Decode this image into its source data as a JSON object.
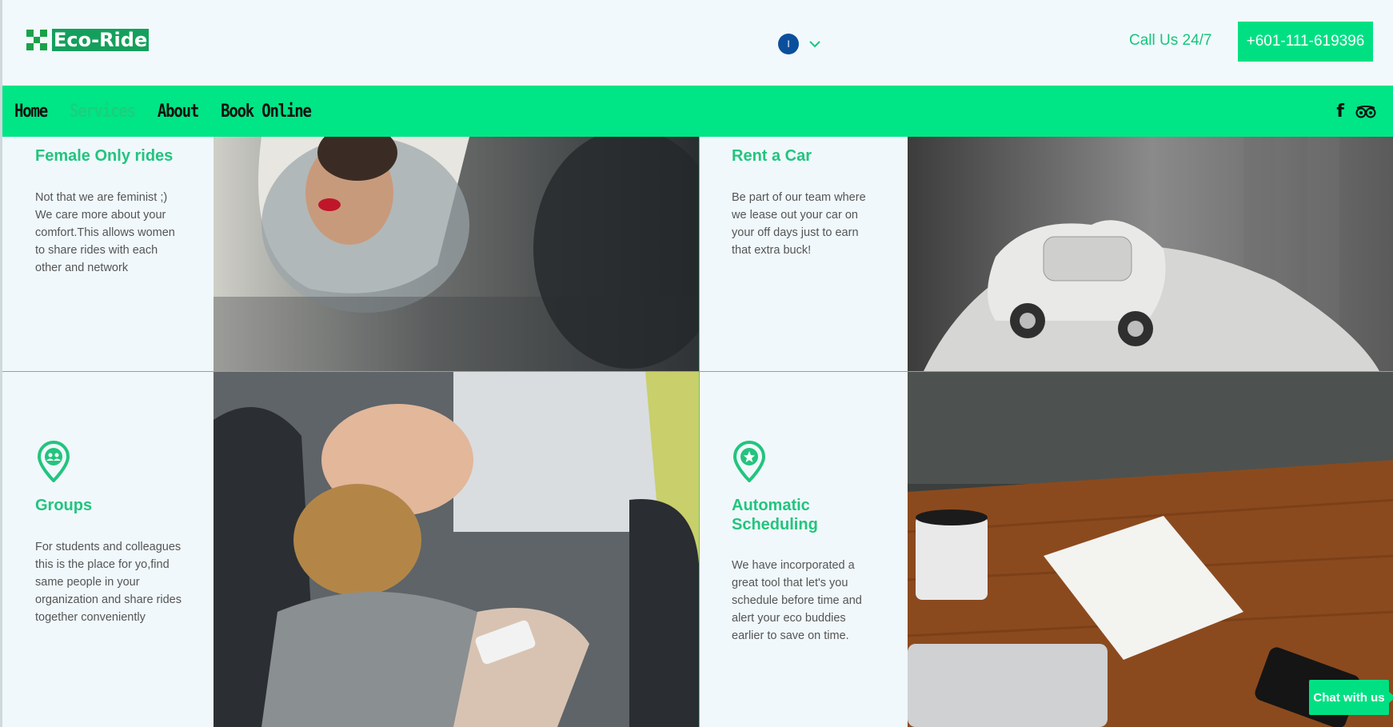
{
  "header": {
    "logo_text": "Eco-Ride",
    "language": "I",
    "call_label": "Call Us 24/7",
    "phone": "+601-111-619396"
  },
  "nav": {
    "items": [
      {
        "label": "Home",
        "active": false
      },
      {
        "label": "Services",
        "active": true
      },
      {
        "label": "About",
        "active": false
      },
      {
        "label": "Book Online",
        "active": false
      }
    ]
  },
  "social": {
    "facebook_icon": "f",
    "tripadvisor_icon": "tripadvisor-icon"
  },
  "services": [
    {
      "title": "Female Only rides",
      "description": "Not that we are feminist ;) We care more about your comfort.This allows women to share rides with each other and network",
      "image": "woman-applying-lipstick-in-car-mirror"
    },
    {
      "title": "Rent a Car",
      "description": "Be part of our team where we lease out your car on your off days just to earn that extra buck!",
      "image": "toy-car-in-hand"
    },
    {
      "title": "Groups",
      "description": "For students and colleagues this is the place for yo,find same people in your organization and share rides together conveniently",
      "icon": "group-pin-icon",
      "image": "friends-looking-at-phone-in-bus"
    },
    {
      "title": "Automatic Scheduling",
      "description": "We have incorporated a great tool that let's you schedule before time and alert your eco buddies earlier to save on time.",
      "icon": "star-pin-icon",
      "image": "coffee-notepad-laptop-on-desk"
    }
  ],
  "chat": {
    "label": "Chat with us"
  },
  "colors": {
    "accent": "#00e585",
    "title": "#23c47e",
    "logo_bg": "#14a05c",
    "lang": "#0b4f9c"
  }
}
